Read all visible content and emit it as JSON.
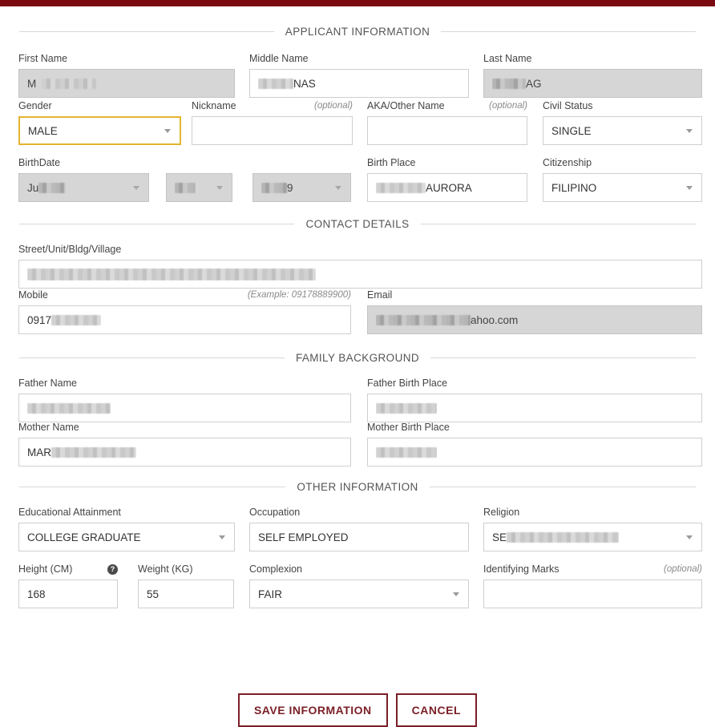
{
  "theme": {
    "accent": "#7a0a10",
    "button_color": "#7a1f27",
    "focus_border": "#e3b430"
  },
  "sections": {
    "applicant": "APPLICANT INFORMATION",
    "contact": "CONTACT DETAILS",
    "family": "FAMILY BACKGROUND",
    "other": "OTHER INFORMATION"
  },
  "labels": {
    "first_name": "First Name",
    "middle_name": "Middle Name",
    "last_name": "Last Name",
    "gender": "Gender",
    "nickname": "Nickname",
    "aka": "AKA/Other Name",
    "civil_status": "Civil Status",
    "birthdate": "BirthDate",
    "birth_place": "Birth Place",
    "citizenship": "Citizenship",
    "street": "Street/Unit/Bldg/Village",
    "mobile": "Mobile",
    "email": "Email",
    "father_name": "Father Name",
    "father_birth_place": "Father Birth Place",
    "mother_name": "Mother Name",
    "mother_birth_place": "Mother Birth Place",
    "education": "Educational Attainment",
    "occupation": "Occupation",
    "religion": "Religion",
    "height": "Height (CM)",
    "weight": "Weight (KG)",
    "complexion": "Complexion",
    "identifying_marks": "Identifying Marks",
    "optional": "(optional)",
    "mobile_example": "(Example: 09178889900)"
  },
  "values": {
    "first_name": "M",
    "middle_name": "NAS",
    "last_name": "AG",
    "gender": "MALE",
    "nickname": "",
    "aka": "",
    "civil_status": "SINGLE",
    "birth_month": "Ju",
    "birth_day": "",
    "birth_year": "9",
    "birth_place": "AURORA",
    "citizenship": "FILIPINO",
    "street": "",
    "mobile": "0917",
    "email": "ahoo.com",
    "father_name": "",
    "father_birth_place": "",
    "mother_name": "MAR",
    "mother_birth_place": "",
    "education": "COLLEGE GRADUATE",
    "occupation": "SELF EMPLOYED",
    "religion": "SE",
    "height": "168",
    "weight": "55",
    "complexion": "FAIR",
    "identifying_marks": ""
  },
  "buttons": {
    "save": "SAVE INFORMATION",
    "cancel": "CANCEL"
  },
  "icons": {
    "help": "?"
  }
}
